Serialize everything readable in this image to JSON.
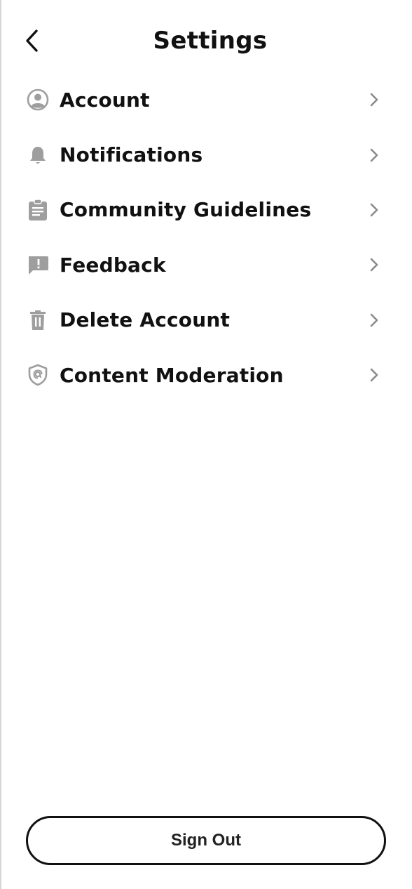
{
  "header": {
    "title": "Settings",
    "back_icon": "chevron-left-icon"
  },
  "menu": {
    "items": [
      {
        "label": "Account",
        "icon": "account-circle-icon"
      },
      {
        "label": "Notifications",
        "icon": "bell-icon"
      },
      {
        "label": "Community Guidelines",
        "icon": "clipboard-icon"
      },
      {
        "label": "Feedback",
        "icon": "feedback-icon"
      },
      {
        "label": "Delete Account",
        "icon": "trash-icon"
      },
      {
        "label": "Content Moderation",
        "icon": "shield-icon"
      }
    ],
    "chevron_icon": "chevron-right-icon"
  },
  "footer": {
    "sign_out_label": "Sign Out"
  },
  "colors": {
    "icon": "#9e9e9e",
    "chevron": "#8a8a8a",
    "text": "#111111",
    "border": "#111111"
  }
}
